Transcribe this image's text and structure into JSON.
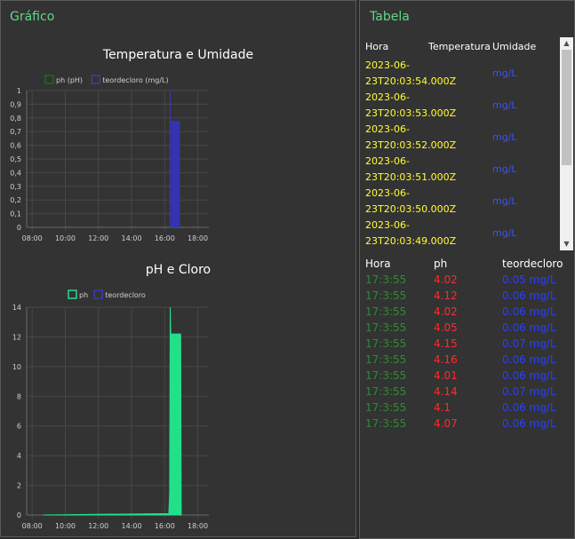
{
  "left": {
    "title": "Gráfico",
    "chart1": {
      "title": "Temperatura e Umidade",
      "legend": [
        {
          "label": "ph (pH)",
          "color": "#1e6b1e"
        },
        {
          "label": "teordecloro (mg/L)",
          "color": "#3b3bb0"
        }
      ],
      "y_ticks": [
        "1",
        "0,9",
        "0,8",
        "0,7",
        "0,6",
        "0,5",
        "0,4",
        "0,3",
        "0,2",
        "0,1",
        "0"
      ],
      "x_ticks": [
        "08:00",
        "10:00",
        "12:00",
        "14:00",
        "16:00",
        "18:00"
      ]
    },
    "chart2": {
      "title": "pH e Cloro",
      "legend": [
        {
          "label": "ph",
          "color": "#22e08a"
        },
        {
          "label": "teordecloro",
          "color": "#3b3bb0"
        }
      ],
      "y_ticks": [
        "14",
        "12",
        "10",
        "8",
        "6",
        "4",
        "2",
        "0"
      ],
      "x_ticks": [
        "08:00",
        "10:00",
        "12:00",
        "14:00",
        "16:00",
        "18:00"
      ]
    }
  },
  "chart_data": [
    {
      "type": "bar",
      "title": "Temperatura e Umidade",
      "x_unit": "time",
      "xlim": [
        "07:40",
        "18:40"
      ],
      "ylim": [
        0,
        1
      ],
      "series": [
        {
          "name": "ph (pH)",
          "values": []
        },
        {
          "name": "teordecloro (mg/L)",
          "bar": {
            "start": "16:23",
            "end": "16:55",
            "value": 0.78
          },
          "spike": {
            "at": "16:20",
            "value": 1.0
          }
        }
      ]
    },
    {
      "type": "area",
      "title": "pH e Cloro",
      "x_unit": "time",
      "xlim": [
        "07:40",
        "18:40"
      ],
      "ylim": [
        0,
        14
      ],
      "series": [
        {
          "name": "ph",
          "points": [
            [
              "08:40",
              0
            ],
            [
              "16:15",
              0.1
            ],
            [
              "16:18",
              1.5
            ],
            [
              "16:20",
              14
            ],
            [
              "16:22",
              12.2
            ],
            [
              "16:58",
              12.2
            ],
            [
              "17:00",
              0
            ]
          ]
        },
        {
          "name": "teordecloro",
          "points": []
        }
      ]
    }
  ],
  "right": {
    "title": "Tabela",
    "table1": {
      "headers": [
        "Hora",
        "Temperatura",
        "Umidade"
      ],
      "rows": [
        {
          "hora": "2023-06-23T20:03:54.000Z",
          "umidade": "mg/L"
        },
        {
          "hora": "2023-06-23T20:03:53.000Z",
          "umidade": "mg/L"
        },
        {
          "hora": "2023-06-23T20:03:52.000Z",
          "umidade": "mg/L"
        },
        {
          "hora": "2023-06-23T20:03:51.000Z",
          "umidade": "mg/L"
        },
        {
          "hora": "2023-06-23T20:03:50.000Z",
          "umidade": "mg/L"
        },
        {
          "hora": "2023-06-23T20:03:49.000Z",
          "umidade": "mg/L"
        }
      ]
    },
    "table2": {
      "headers": [
        "Hora",
        "ph",
        "teordecloro"
      ],
      "rows": [
        {
          "hora": "17:3:55",
          "ph": "4.02",
          "cloro": "0.05 mg/L"
        },
        {
          "hora": "17:3:55",
          "ph": "4.12",
          "cloro": "0.06 mg/L"
        },
        {
          "hora": "17:3:55",
          "ph": "4.02",
          "cloro": "0.06 mg/L"
        },
        {
          "hora": "17:3:55",
          "ph": "4.05",
          "cloro": "0.06 mg/L"
        },
        {
          "hora": "17:3:55",
          "ph": "4.15",
          "cloro": "0.07 mg/L"
        },
        {
          "hora": "17:3:55",
          "ph": "4.16",
          "cloro": "0.06 mg/L"
        },
        {
          "hora": "17:3:55",
          "ph": "4.01",
          "cloro": "0.06 mg/L"
        },
        {
          "hora": "17:3:55",
          "ph": "4.14",
          "cloro": "0.07 mg/L"
        },
        {
          "hora": "17:3:55",
          "ph": "4.1",
          "cloro": "0.06 mg/L"
        },
        {
          "hora": "17:3:55",
          "ph": "4.07",
          "cloro": "0.06 mg/L"
        }
      ]
    }
  }
}
